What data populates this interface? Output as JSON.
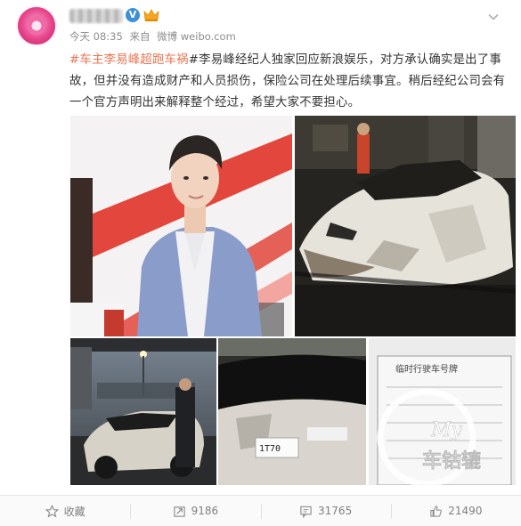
{
  "post": {
    "meta": {
      "time": "今天 08:35",
      "source_prefix": "来自",
      "source": "微博 weibo.com"
    },
    "text": {
      "topic": "#车主李易峰超跑车祸",
      "body": "#李易峰经纪人独家回应新浪娱乐，对方承认确实是出了事故，但并没有造成财产和人员损伤，保险公司在处理后续事宜。稍后经纪公司会有一个官方声明出来解释整个经过，希望大家不要担心。"
    },
    "images": {
      "plate_text": "1T70",
      "document_title": "临时行驶车号牌",
      "watermark_my": "My",
      "watermark_cn": "车钴辘"
    }
  },
  "actions": [
    {
      "label": "收藏",
      "icon": "star-icon"
    },
    {
      "label": "9186",
      "icon": "share-icon"
    },
    {
      "label": "31765",
      "icon": "comment-icon"
    },
    {
      "label": "21490",
      "icon": "thumbs-up-icon"
    }
  ]
}
